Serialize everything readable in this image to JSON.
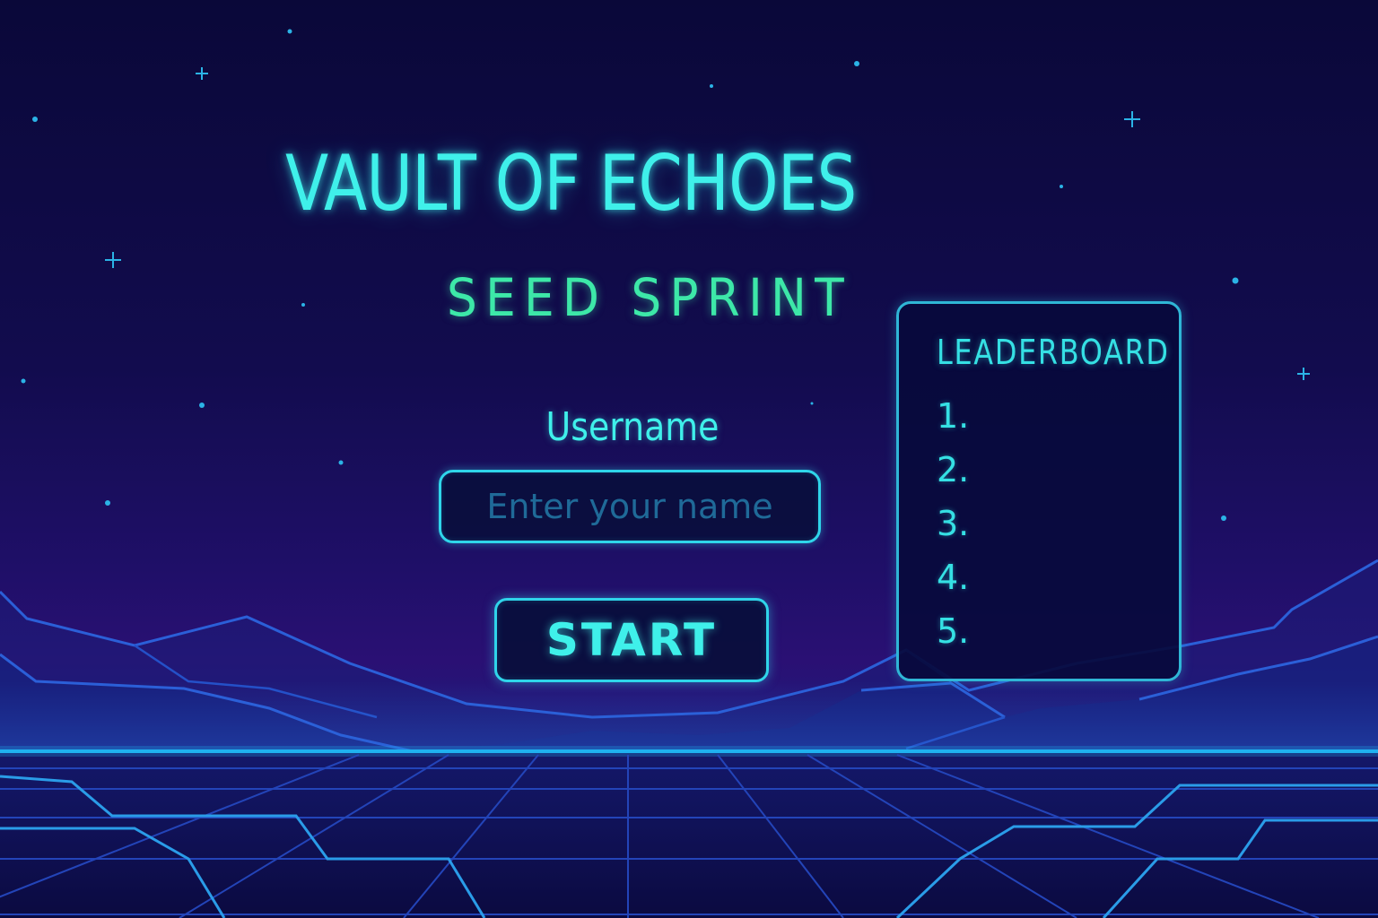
{
  "game": {
    "title": "VAULT OF ECHOES",
    "subtitle": "SEED SPRINT"
  },
  "form": {
    "username_label": "Username",
    "username_placeholder": "Enter your name",
    "username_value": "",
    "start_label": "START"
  },
  "leaderboard": {
    "title": "LEADERBOARD",
    "entries": [
      {
        "rank": "1."
      },
      {
        "rank": "2."
      },
      {
        "rank": "3."
      },
      {
        "rank": "4."
      },
      {
        "rank": "5."
      }
    ]
  },
  "colors": {
    "background_top": "#0a0839",
    "background_horizon": "#2a1074",
    "neon_cyan": "#3ff0ea",
    "neon_green": "#3de8a8",
    "border_cyan": "#2fd5ea",
    "grid_blue": "#2b5fd8"
  }
}
